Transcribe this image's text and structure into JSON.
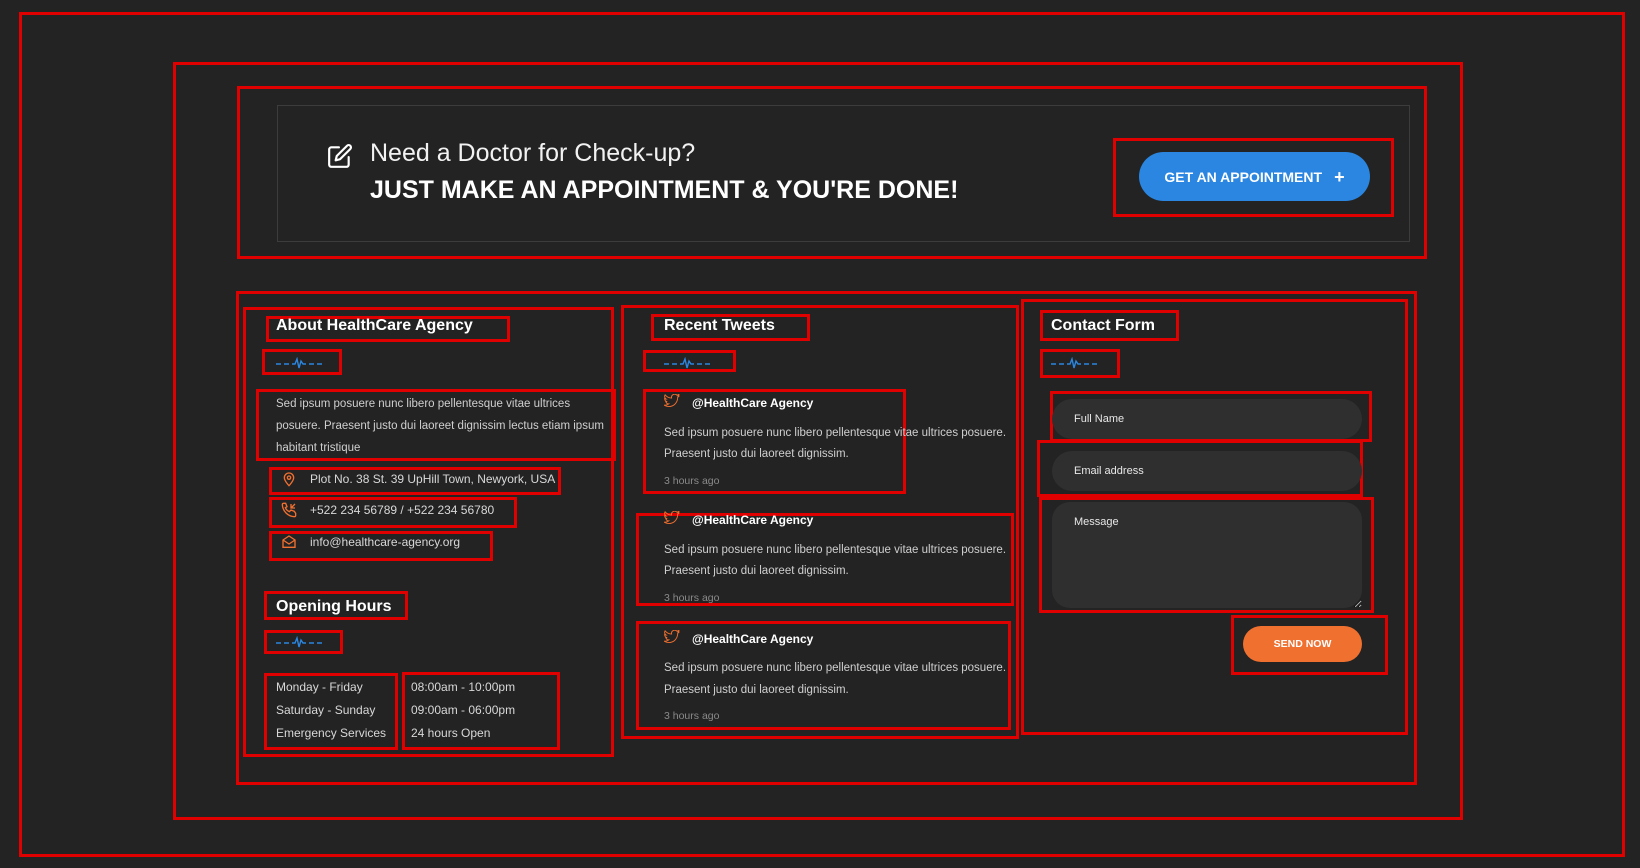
{
  "cta": {
    "question": "Need a Doctor for Check-up?",
    "headline": "JUST MAKE AN APPOINTMENT & YOU'RE DONE!",
    "button_label": "GET AN APPOINTMENT",
    "button_icon": "+",
    "icon": "edit-icon"
  },
  "about": {
    "title": "About HealthCare Agency",
    "description": "Sed ipsum posuere nunc libero pellentesque vitae ultrices posuere. Praesent justo dui laoreet dignissim lectus etiam ipsum habitant tristique",
    "address": "Plot No. 38 St. 39 UpHill Town, Newyork, USA",
    "phone": "+522 234 56789 / +522 234 56780",
    "email": "info@healthcare-agency.org"
  },
  "hours": {
    "title": "Opening Hours",
    "days": [
      "Monday - Friday",
      "Saturday - Sunday",
      "Emergency Services"
    ],
    "times": [
      "08:00am - 10:00pm",
      "09:00am - 06:00pm",
      "24 hours Open"
    ]
  },
  "tweets": {
    "title": "Recent Tweets",
    "items": [
      {
        "handle": "@HealthCare Agency",
        "line1": "Sed ipsum posuere nunc libero pellentesque vitae ultrices posuere.",
        "line2": "Praesent justo dui laoreet dignissim.",
        "time": "3 hours ago"
      },
      {
        "handle": "@HealthCare Agency",
        "line1": "Sed ipsum posuere nunc libero pellentesque vitae ultrices posuere.",
        "line2": "Praesent justo dui laoreet dignissim.",
        "time": "3 hours ago"
      },
      {
        "handle": "@HealthCare Agency",
        "line1": "Sed ipsum posuere nunc libero pellentesque vitae ultrices posuere.",
        "line2": "Praesent justo dui laoreet dignissim.",
        "time": "3 hours ago"
      }
    ]
  },
  "contact": {
    "title": "Contact Form",
    "name_placeholder": "Full Name",
    "email_placeholder": "Email address",
    "message_placeholder": "Message",
    "send_label": "SEND NOW"
  },
  "colors": {
    "background": "#232323",
    "accent_blue": "#2a86e0",
    "accent_orange": "#f07030",
    "annotation_red": "#e00000"
  }
}
